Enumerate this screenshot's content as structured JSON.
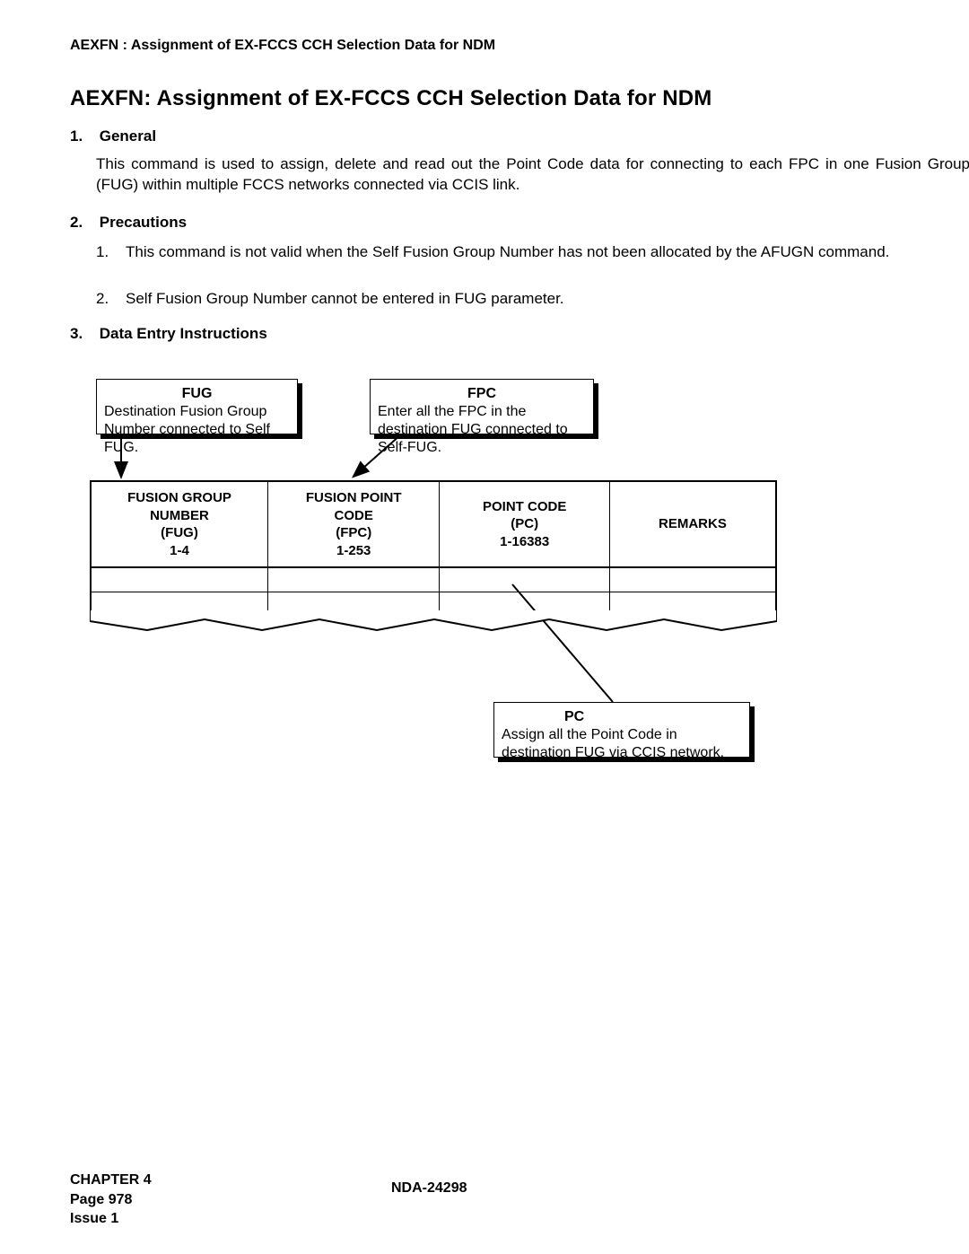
{
  "running_head": "AEXFN : Assignment of EX-FCCS CCH Selection Data for NDM",
  "title": "AEXFN: Assignment of EX-FCCS CCH Selection Data for NDM",
  "sections": {
    "general": {
      "num": "1.",
      "heading": "General",
      "body": "This command is used to assign, delete and read out the Point Code data for connecting to each FPC in one Fusion Group (FUG) within multiple FCCS networks connected via CCIS link."
    },
    "precautions": {
      "num": "2.",
      "heading": "Precautions",
      "items": {
        "a": {
          "num": "1.",
          "text": "This command is not valid when the Self Fusion Group Number has not been allocated by the AFUGN command."
        },
        "b": {
          "num": "2.",
          "text": "Self Fusion Group Number cannot be entered in FUG parameter."
        }
      }
    },
    "instructions": {
      "num": "3.",
      "heading": "Data Entry Instructions"
    }
  },
  "callouts": {
    "fug": {
      "title": "FUG",
      "desc": "Destination Fusion Group Number connected to Self FUG."
    },
    "fpc": {
      "title": "FPC",
      "desc": "Enter all the FPC in the destination FUG connected to Self-FUG."
    },
    "pc": {
      "title": "PC",
      "desc": "Assign all the Point Code in destination FUG via CCIS network."
    }
  },
  "table": {
    "headers": {
      "c1a": "FUSION GROUP",
      "c1b": "NUMBER",
      "c1c": "(FUG)",
      "c1d": "1-4",
      "c2a": "FUSION POINT",
      "c2b": "CODE",
      "c2c": "(FPC)",
      "c2d": "1-253",
      "c3a": "POINT CODE",
      "c3b": "(PC)",
      "c3c": "1-16383",
      "c4": "REMARKS"
    }
  },
  "footer": {
    "chapter": "CHAPTER 4",
    "page": "Page 978",
    "issue": "Issue 1",
    "docnum": "NDA-24298"
  }
}
